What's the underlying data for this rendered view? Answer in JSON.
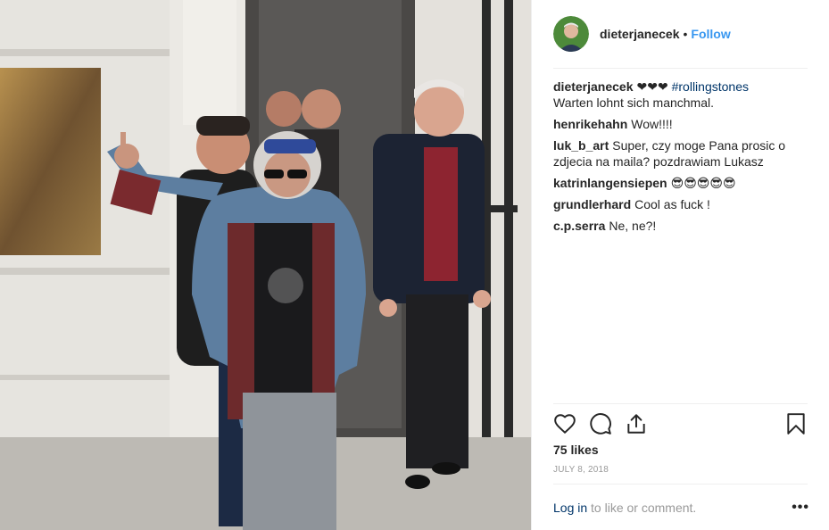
{
  "post": {
    "username": "dieterjanecek",
    "follow_label": "Follow",
    "separator": "•",
    "caption_hearts": "❤❤❤",
    "caption_hashtag": "#rollingstones",
    "caption_text": "Warten lohnt sich manchmal.",
    "likes": "75 likes",
    "date": "July 8, 2018"
  },
  "comments": [
    {
      "user": "henrikehahn",
      "text": "Wow!!!!"
    },
    {
      "user": "luk_b_art",
      "text": "Super, czy moge Pana prosic o zdjecia na maila? pozdrawiam Lukasz"
    },
    {
      "user": "katrinlangensiepen",
      "text": "😎😎😎😎😎"
    },
    {
      "user": "grundlerhard",
      "text": "Cool as fuck !"
    },
    {
      "user": "c.p.serra",
      "text": "Ne, ne?!"
    }
  ],
  "footer": {
    "login_label": "Log in",
    "login_suffix": "to like or comment.",
    "more_label": "•••"
  },
  "icons": {
    "like": "heart-icon",
    "comment": "comment-icon",
    "share": "share-icon",
    "save": "bookmark-icon",
    "more": "more-options-icon"
  },
  "colors": {
    "accent": "#3897f0",
    "link": "#003569",
    "muted": "#999999"
  }
}
